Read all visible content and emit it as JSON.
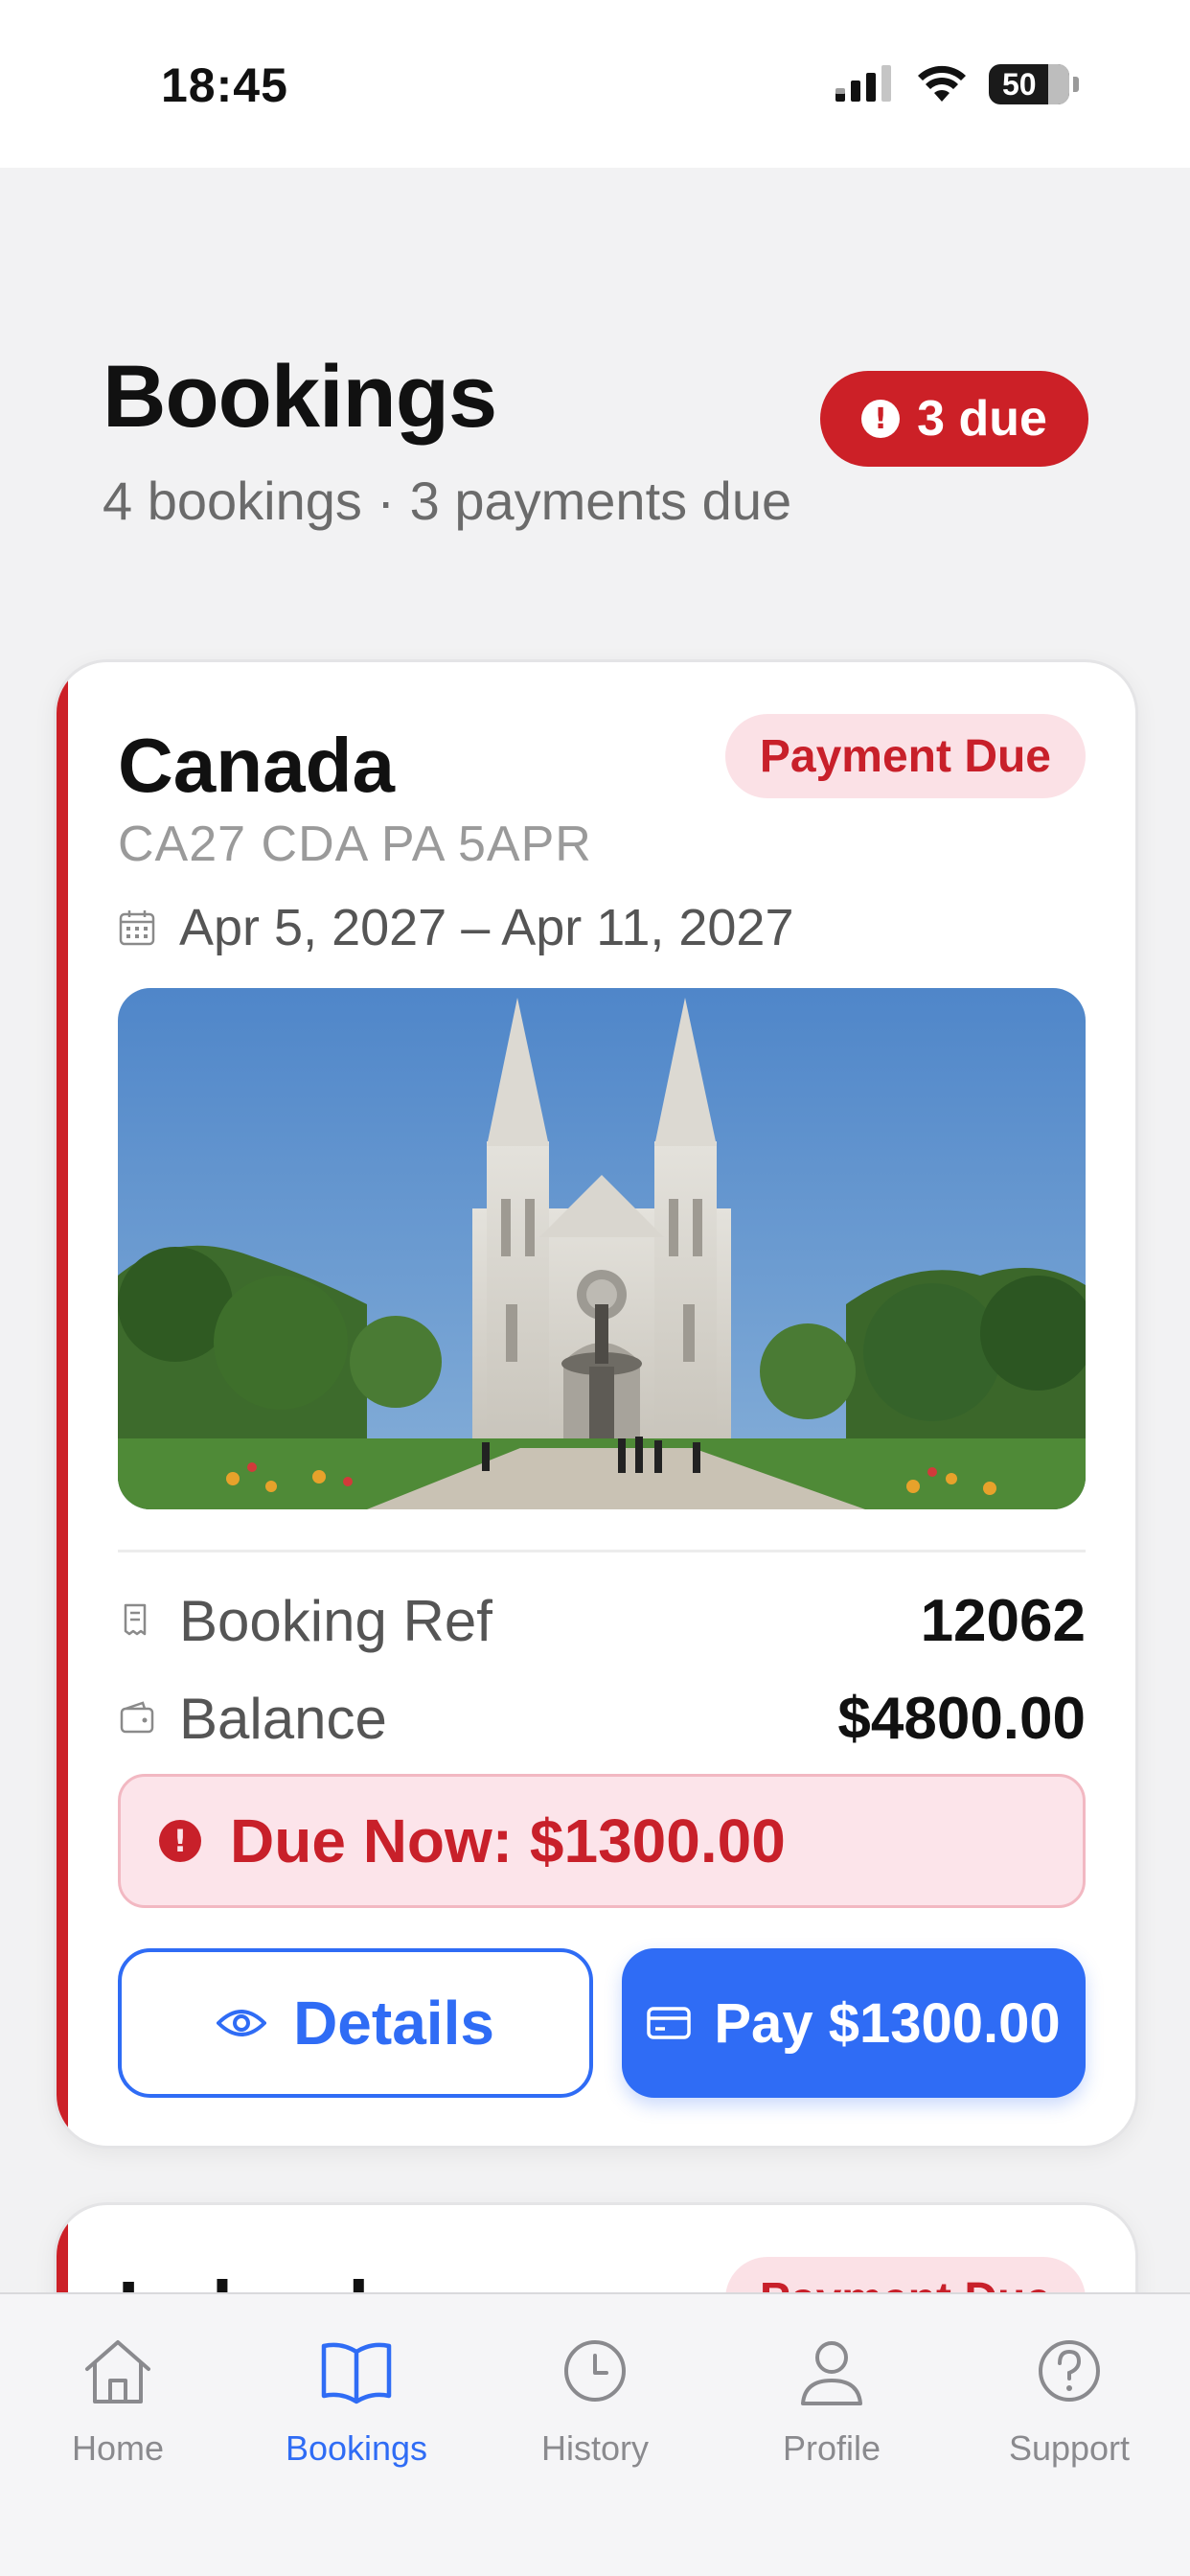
{
  "status_bar": {
    "time": "18:45",
    "battery": "50"
  },
  "header": {
    "title": "Bookings",
    "subtitle": "4 bookings · 3 payments due",
    "due_pill": "3 due"
  },
  "bookings": [
    {
      "destination": "Canada",
      "status": "Payment Due",
      "code": "CA27 CDA PA 5APR",
      "dates": "Apr 5, 2027 – Apr 11, 2027",
      "image_icon": "basilica-photo",
      "ref_label": "Booking Ref",
      "ref_value": "12062",
      "balance_label": "Balance",
      "balance_value": "$4800.00",
      "due_now": "Due Now: $1300.00",
      "details_label": "Details",
      "pay_label": "Pay $1300.00"
    },
    {
      "destination": "Ireland",
      "status": "Payment Due"
    }
  ],
  "tabs": [
    {
      "label": "Home",
      "icon": "home-icon",
      "active": false
    },
    {
      "label": "Bookings",
      "icon": "book-icon",
      "active": true
    },
    {
      "label": "History",
      "icon": "clock-icon",
      "active": false
    },
    {
      "label": "Profile",
      "icon": "person-icon",
      "active": false
    },
    {
      "label": "Support",
      "icon": "help-icon",
      "active": false
    }
  ],
  "colors": {
    "accent": "#2f6cf5",
    "danger": "#cc2027",
    "danger_bg": "#fce4ea"
  }
}
